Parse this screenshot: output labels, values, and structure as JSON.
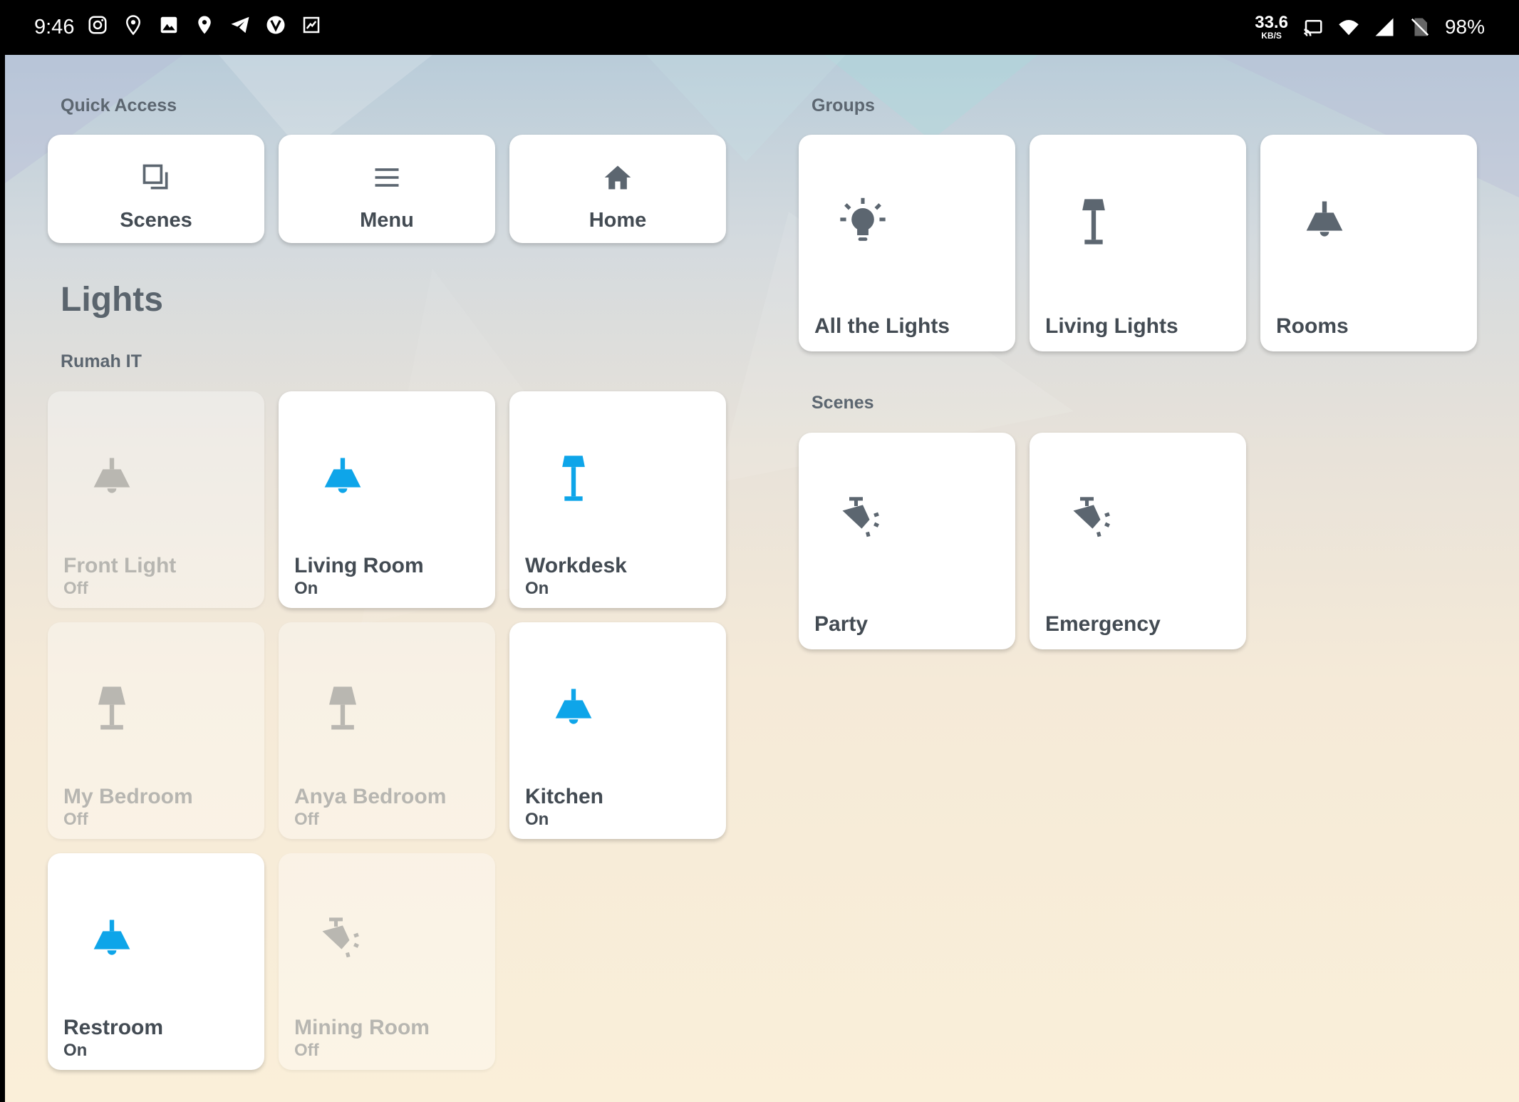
{
  "status_bar": {
    "time": "9:46",
    "net_speed_value": "33.6",
    "net_speed_unit": "KB/S",
    "battery": "98%"
  },
  "quick_access": {
    "label": "Quick Access",
    "items": [
      {
        "label": "Scenes",
        "icon": "scenes-icon"
      },
      {
        "label": "Menu",
        "icon": "menu-icon"
      },
      {
        "label": "Home",
        "icon": "home-icon"
      }
    ]
  },
  "lights": {
    "title": "Lights",
    "subtitle": "Rumah IT",
    "items": [
      {
        "name": "Front Light",
        "state": "Off",
        "icon": "ceiling-lamp-icon"
      },
      {
        "name": "Living Room",
        "state": "On",
        "icon": "ceiling-lamp-icon"
      },
      {
        "name": "Workdesk",
        "state": "On",
        "icon": "floor-lamp-icon"
      },
      {
        "name": "My Bedroom",
        "state": "Off",
        "icon": "desk-lamp-icon"
      },
      {
        "name": "Anya Bedroom",
        "state": "Off",
        "icon": "desk-lamp-icon"
      },
      {
        "name": "Kitchen",
        "state": "On",
        "icon": "ceiling-lamp-icon"
      },
      {
        "name": "Restroom",
        "state": "On",
        "icon": "ceiling-lamp-icon"
      },
      {
        "name": "Mining Room",
        "state": "Off",
        "icon": "spotlight-icon"
      }
    ]
  },
  "groups": {
    "label": "Groups",
    "items": [
      {
        "name": "All the Lights",
        "icon": "lightbulb-icon"
      },
      {
        "name": "Living Lights",
        "icon": "floor-lamp-icon"
      },
      {
        "name": "Rooms",
        "icon": "ceiling-lamp-icon"
      }
    ]
  },
  "scenes": {
    "label": "Scenes",
    "items": [
      {
        "name": "Party",
        "icon": "spotlight-icon"
      },
      {
        "name": "Emergency",
        "icon": "spotlight-icon"
      }
    ]
  },
  "colors": {
    "on": "#0ea5e9",
    "off": "#b9b7b1",
    "neutral": "#5c6670"
  }
}
